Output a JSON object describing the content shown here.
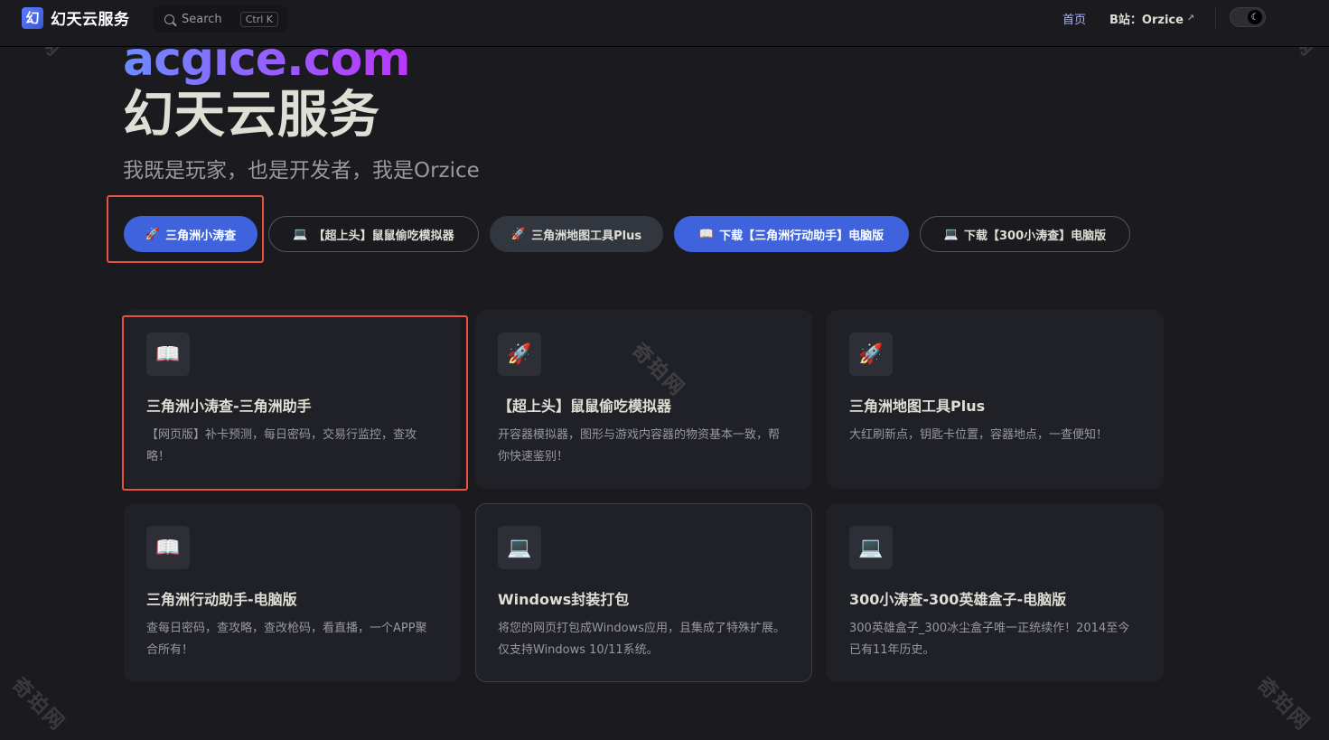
{
  "nav": {
    "logo_glyph": "幻",
    "logo_text": "幻天云服务",
    "search_placeholder": "Search",
    "search_shortcut": "Ctrl K",
    "home_link": "首页",
    "bili_link": "B站：Orzice",
    "ext_icon": "↗",
    "theme_icon": "moon-icon"
  },
  "hero": {
    "name": "acgice.com",
    "title": "幻天云服务",
    "tagline": "我既是玩家，也是开发者，我是Orzice"
  },
  "actions": [
    {
      "icon": "🚀",
      "label": "三角洲小涛查",
      "style": "brand"
    },
    {
      "icon": "💻",
      "label": "【超上头】鼠鼠偷吃模拟器",
      "style": "outline"
    },
    {
      "icon": "🚀",
      "label": "三角洲地图工具Plus",
      "style": "alt"
    },
    {
      "icon": "📖",
      "label": "下载【三角洲行动助手】电脑版",
      "style": "brand"
    },
    {
      "icon": "💻",
      "label": "下载【300小涛查】电脑版",
      "style": "outline"
    }
  ],
  "features": [
    {
      "icon": "📖",
      "title": "三角洲小涛查-三角洲助手",
      "desc": "【网页版】补卡预测，每日密码，交易行监控，查攻略！"
    },
    {
      "icon": "🚀",
      "title": "【超上头】鼠鼠偷吃模拟器",
      "desc": "开容器模拟器，图形与游戏内容器的物资基本一致，帮你快速鉴别！"
    },
    {
      "icon": "🚀",
      "title": "三角洲地图工具Plus",
      "desc": "大红刷新点，钥匙卡位置，容器地点，一查便知！"
    },
    {
      "icon": "📖",
      "title": "三角洲行动助手-电脑版",
      "desc": "查每日密码，查攻略，查改枪码，看直播，一个APP聚合所有！"
    },
    {
      "icon": "💻",
      "title": "Windows封装打包",
      "desc": "将您的网页打包成Windows应用，且集成了特殊扩展。仅支持Windows 10/11系统。"
    },
    {
      "icon": "💻",
      "title": "300小涛查-300英雄盒子-电脑版",
      "desc": "300英雄盒子_300冰尘盒子唯一正统续作！2014至今已有11年历史。"
    }
  ],
  "watermark": "奇珀网",
  "colors": {
    "background": "#1b1b1f",
    "brand": "#3e63dd",
    "card": "#202127",
    "highlight": "#e5533e"
  }
}
